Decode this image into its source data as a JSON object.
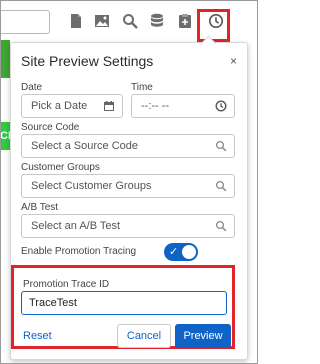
{
  "toolbar": {
    "icons": [
      "document-icon",
      "image-icon",
      "search-icon",
      "database-icon",
      "clipboard-icon",
      "history-icon"
    ]
  },
  "background": {
    "button_label": "CK"
  },
  "panel": {
    "title": "Site Preview Settings",
    "close": "×",
    "date_label": "Date",
    "date_placeholder": "Pick a Date",
    "time_label": "Time",
    "time_placeholder": "--:-- --",
    "source_code_label": "Source Code",
    "source_code_placeholder": "Select a Source Code",
    "customer_groups_label": "Customer Groups",
    "customer_groups_placeholder": "Select Customer Groups",
    "ab_test_label": "A/B Test",
    "ab_test_placeholder": "Select an A/B Test",
    "promotion_tracing_label": "Enable Promotion Tracing",
    "promotion_tracing_enabled": true,
    "trace_id_label": "Promotion Trace ID",
    "trace_id_value": "TraceTest",
    "reset_label": "Reset",
    "cancel_label": "Cancel",
    "preview_label": "Preview"
  },
  "colors": {
    "accent": "#0f63c7",
    "highlight": "#e0242a",
    "bg_green": "#2ecc40"
  }
}
